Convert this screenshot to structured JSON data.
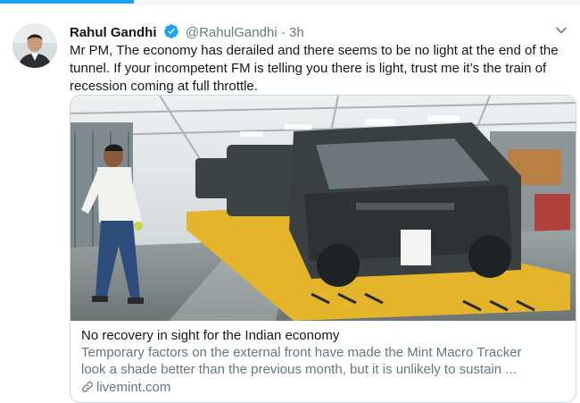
{
  "tweet": {
    "author_name": "Rahul Gandhi",
    "author_handle": "@RahulGandhi",
    "separator": "·",
    "time": "3h",
    "text": "Mr PM, The economy has derailed and there seems to be no light at the end of the tunnel. If your incompetent FM is telling you there is light, trust me it’s the train of recession coming at full throttle."
  },
  "card": {
    "title": "No recovery in sight for the Indian economy",
    "description": "Temporary factors on the external front have made the Mint Macro Tracker look a shade better than the previous month, but it is unlikely to sustain ...",
    "description_line1": "Temporary factors on the external front have made the Mint Macro Tracker",
    "description_line2": "look a shade better than the previous month, but it is unlikely to sustain ...",
    "domain": "livemint.com",
    "image": "car assembly line with worker"
  },
  "icons": {
    "verified": "verified-badge-icon",
    "caret": "chevron-down-icon",
    "link": "link-icon"
  },
  "colors": {
    "accent": "#1da1f2",
    "secondary_text": "#657786",
    "border": "#ccd6dd"
  }
}
